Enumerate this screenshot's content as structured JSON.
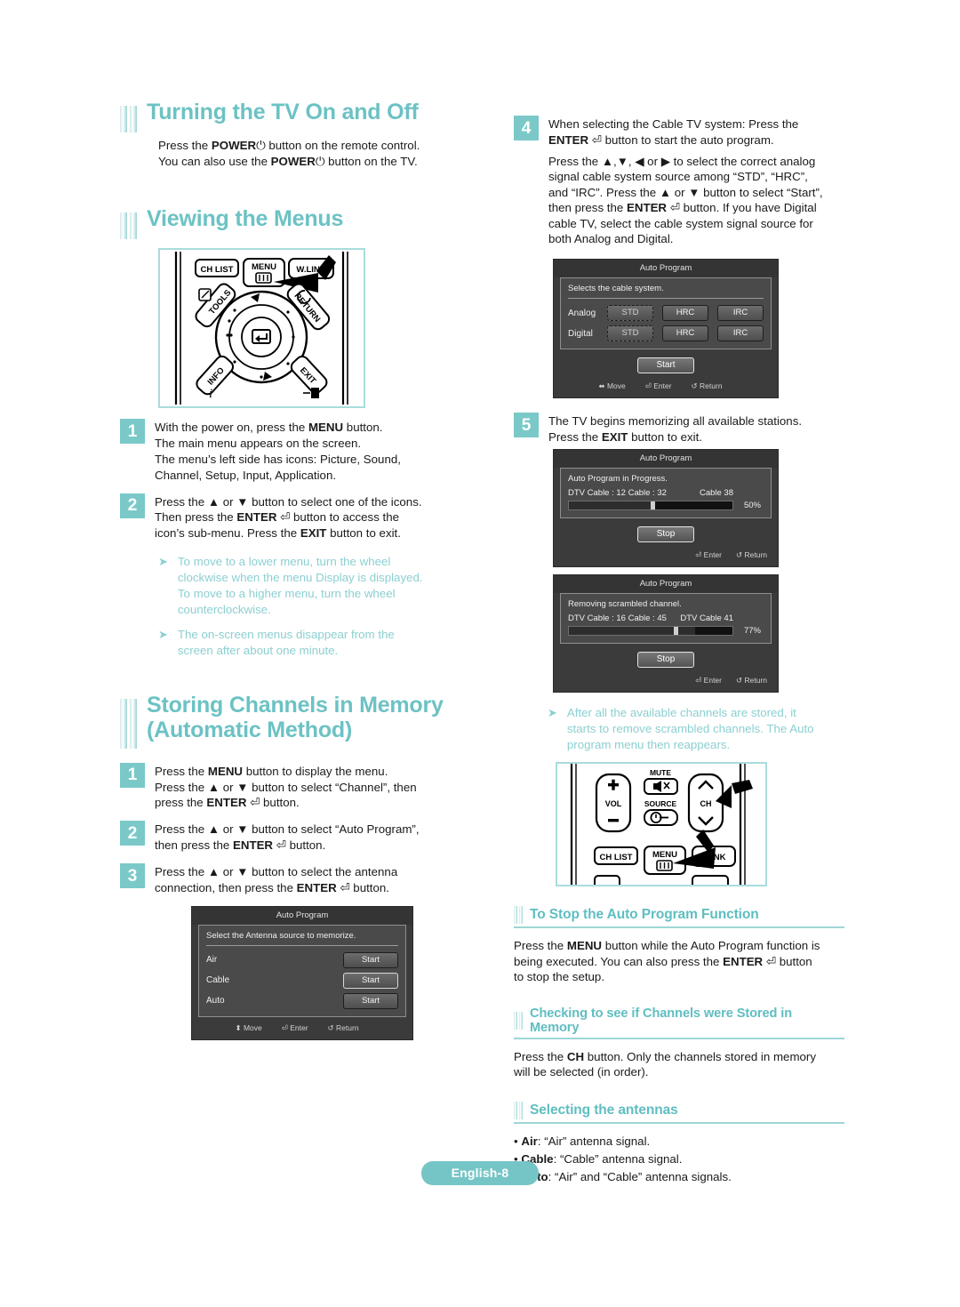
{
  "page": {
    "footer_label": "English-8",
    "accent_color": "#6cc2c4",
    "step_badge_color": "#7ac9c8",
    "note_color": "#8ccfd0"
  },
  "left_column": {
    "section1": {
      "title": "Turning the TV On and Off",
      "paragraph_line1_a": "Press the ",
      "paragraph_line1_b": "POWER",
      "paragraph_line1_c": " button on the remote control.",
      "paragraph_line2_a": "You can also use the ",
      "paragraph_line2_b": "POWER",
      "paragraph_line2_c": " button on the TV."
    },
    "section2": {
      "title": "Viewing the Menus",
      "remote": {
        "buttons": [
          "CH LIST",
          "MENU",
          "W.LINK",
          "TOOLS",
          "RETURN",
          "INFO",
          "EXIT"
        ],
        "center_button": "ENTER"
      },
      "steps": [
        {
          "number": "1",
          "lines": [
            "With the power on, press the MENU button.",
            "The main menu appears on the screen.",
            "The menu’s left side has icons: Picture, Sound,",
            "Channel, Setup, Input, Application."
          ]
        },
        {
          "number": "2",
          "lines": [
            "Press the ▲ or ▼ button to select one of the icons.",
            "Then press the ENTER ↵ button to access the",
            "icon’s sub-menu. Press the EXIT button to exit."
          ]
        }
      ],
      "notes": [
        "To move to a lower menu, turn the wheel clockwise when the menu Display is displayed. To move to a higher menu, turn the wheel counterclockwise.",
        "The on-screen menus disappear from the screen after about one minute."
      ]
    },
    "section3": {
      "title_line1": "Storing Channels in Memory",
      "title_line2": "(Automatic Method)",
      "steps": [
        {
          "number": "1",
          "lines": [
            "Press the MENU button to display the menu.",
            "Press the ▲ or ▼ button to select “Channel”, then",
            "press the ENTER ↵ button."
          ]
        },
        {
          "number": "2",
          "lines": [
            "Press the ▲ or ▼ button to select “Auto Program”,",
            "then press the ENTER ↵ button."
          ]
        },
        {
          "number": "3",
          "lines": [
            "Press the ▲ or ▼ button to select the antenna",
            "connection, then press the ENTER ↵ button."
          ]
        }
      ],
      "osd_antenna": {
        "title": "Auto Program",
        "description": "Select the Antenna source to memorize.",
        "rows": [
          {
            "label": "Air",
            "button": "Start",
            "selected": false
          },
          {
            "label": "Cable",
            "button": "Start",
            "selected": true
          },
          {
            "label": "Auto",
            "button": "Start",
            "selected": false
          }
        ],
        "footer": [
          "Move",
          "Enter",
          "Return"
        ]
      }
    }
  },
  "right_column": {
    "step4": {
      "number": "4",
      "lines_top": [
        "When selecting the Cable TV system: Press the",
        "ENTER ↵ button to start the auto program."
      ],
      "lines_body": [
        "Press the ▲,▼, ◀ or ▶ to select the correct analog",
        "signal cable system source among “STD”, “HRC”,",
        "and “IRC”. Press the ▲ or ▼ button to select “Start”,",
        "then press the ENTER ↵ button. If you have Digital",
        "cable TV, select the cable system signal source for",
        "both Analog and Digital."
      ]
    },
    "osd_cable_system": {
      "title": "Auto Program",
      "description": "Selects the cable system.",
      "rows": [
        {
          "label": "Analog",
          "options": [
            "STD",
            "HRC",
            "IRC"
          ],
          "selected": "STD"
        },
        {
          "label": "Digital",
          "options": [
            "STD",
            "HRC",
            "IRC"
          ],
          "selected": "STD"
        }
      ],
      "start_button": "Start",
      "footer": [
        "Move",
        "Enter",
        "Return"
      ]
    },
    "step5": {
      "number": "5",
      "lines": [
        "The TV begins memorizing all available stations.",
        "Press the EXIT button to exit."
      ]
    },
    "osd_progress1": {
      "title": "Auto Program",
      "description": "Auto Program in Progress.",
      "left_label": "DTV Cable : 12   Cable : 32",
      "right_label": "Cable 38",
      "percent": "50%",
      "percent_value": 50,
      "stop_button": "Stop",
      "footer": [
        "Enter",
        "Return"
      ]
    },
    "osd_progress2": {
      "title": "Auto Program",
      "description": "Removing scrambled channel.",
      "left_label": "DTV Cable : 16   Cable : 45",
      "right_label": "DTV Cable 41",
      "percent": "77%",
      "percent_value": 77,
      "stop_button": "Stop",
      "footer": [
        "Enter",
        "Return"
      ]
    },
    "note": "After all the available channels are stored, it starts to remove scrambled channels. The Auto program menu then reappears.",
    "remote": {
      "buttons": [
        "VOL",
        "MUTE",
        "SOURCE",
        "CH",
        "CH LIST",
        "MENU",
        "W.LINK"
      ]
    },
    "sub1": {
      "title": "To Stop the Auto Program Function",
      "lines": [
        "Press the MENU button while the Auto Program function is",
        "being executed. You can also press the ENTER ↵ button",
        "to stop the setup."
      ]
    },
    "sub2": {
      "title": "Checking to see if Channels were Stored in Memory",
      "lines": [
        "Press the CH button. Only the channels stored in memory",
        "will be selected (in order)."
      ]
    },
    "sub3": {
      "title": "Selecting the antennas",
      "bullets": [
        {
          "term": "Air",
          "desc": ": “Air” antenna signal."
        },
        {
          "term": "Cable",
          "desc": ": “Cable” antenna signal."
        },
        {
          "term": "Auto",
          "desc": ": “Air” and “Cable” antenna signals."
        }
      ]
    }
  }
}
